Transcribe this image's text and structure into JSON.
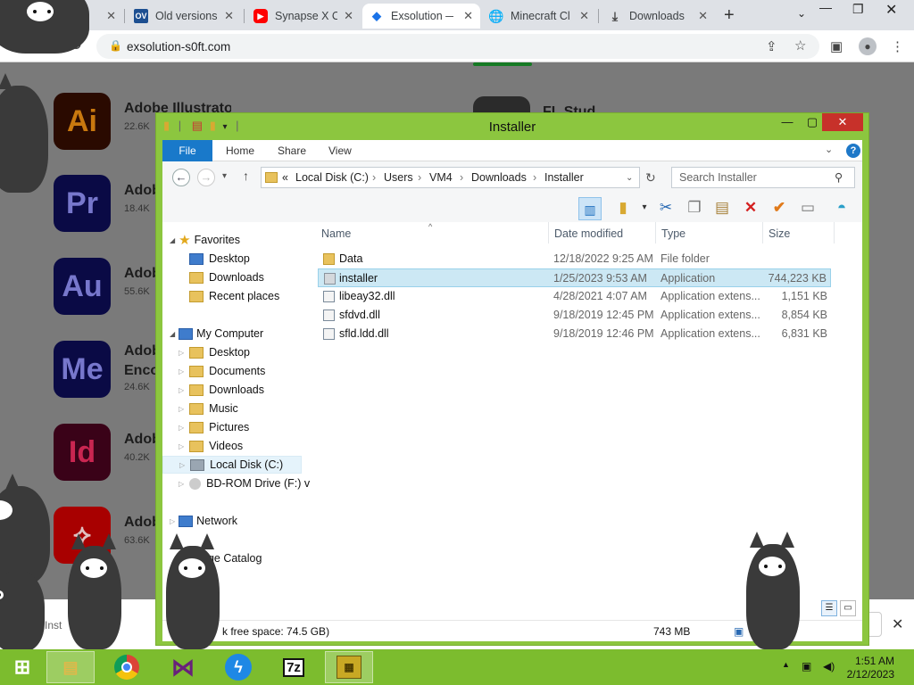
{
  "browser": {
    "tabs": [
      {
        "label": "",
        "icon": "cat-icon"
      },
      {
        "label": "Old versions",
        "icon": "ov-icon",
        "iconText": "OV"
      },
      {
        "label": "Synapse X C",
        "icon": "youtube-icon"
      },
      {
        "label": "Exsolution —",
        "icon": "exsolution-icon"
      },
      {
        "label": "Minecraft Cl",
        "icon": "globe-icon"
      },
      {
        "label": "Downloads",
        "icon": "download-icon"
      }
    ],
    "url": "exsolution-s0ft.com"
  },
  "webpage": {
    "apps": [
      {
        "name": "Adobe Illustrator",
        "downloads": "22.6K",
        "icon": "Ai",
        "bg": "#330000",
        "fg": "#ff9a00"
      },
      {
        "name": "Adobe Premiere Pro",
        "downloads": "18.4K",
        "icon": "Pr",
        "bg": "#00005b",
        "fg": "#9999ff"
      },
      {
        "name": "Adobe Audition",
        "downloads": "55.6K",
        "icon": "Au",
        "bg": "#00005b",
        "fg": "#9999ff"
      },
      {
        "name": "Adobe Media Encoder",
        "name_line2": "Enco",
        "downloads": "24.6K",
        "icon": "Me",
        "bg": "#00005b",
        "fg": "#9999ff"
      },
      {
        "name": "Adobe InDesign",
        "downloads": "40.2K",
        "icon": "Id",
        "bg": "#49021f",
        "fg": "#ff3366"
      },
      {
        "name": "Adobe Acrobat",
        "downloads": "63.6K",
        "icon": "acrobat-icon",
        "bg": "#cf0000",
        "fg": "#ffffff"
      }
    ],
    "right_app": {
      "name": "FL Studio"
    },
    "bottom_text": "Inst"
  },
  "explorer": {
    "title": "Installer",
    "ribbon_tabs": [
      "File",
      "Home",
      "Share",
      "View"
    ],
    "breadcrumb": [
      "«",
      "Local Disk (C:)",
      "Users",
      "VM4",
      "Downloads",
      "Installer"
    ],
    "search_placeholder": "Search Installer",
    "columns": [
      "Name",
      "Date modified",
      "Type",
      "Size"
    ],
    "files": [
      {
        "name": "Data",
        "date": "12/18/2022 9:25 AM",
        "type": "File folder",
        "size": "",
        "icon": "folder-icon"
      },
      {
        "name": "installer",
        "date": "1/25/2023 9:53 AM",
        "type": "Application",
        "size": "744,223 KB",
        "icon": "application-icon",
        "selected": true
      },
      {
        "name": "libeay32.dll",
        "date": "4/28/2021 4:07 AM",
        "type": "Application extens...",
        "size": "1,151 KB",
        "icon": "dll-icon"
      },
      {
        "name": "sfdvd.dll",
        "date": "9/18/2019 12:45 PM",
        "type": "Application extens...",
        "size": "8,854 KB",
        "icon": "dll-icon"
      },
      {
        "name": "sfld.ldd.dll",
        "date": "9/18/2019 12:46 PM",
        "type": "Application extens...",
        "size": "6,831 KB",
        "icon": "dll-icon"
      }
    ],
    "nav": {
      "favorites": "Favorites",
      "fav_items": [
        "Desktop",
        "Downloads",
        "Recent places"
      ],
      "computer": "My Computer",
      "comp_items": [
        "Desktop",
        "Documents",
        "Downloads",
        "Music",
        "Pictures",
        "Videos",
        "Local Disk (C:)",
        "BD-ROM Drive (F:) v"
      ],
      "network": "Network",
      "catalog": "age Catalog"
    },
    "status_left": "k free space: 74.5 GB)",
    "status_right": "743 MB"
  },
  "taskbar": {
    "time": "1:51 AM",
    "date": "2/12/2023",
    "apps": [
      "file-explorer",
      "chrome",
      "visual-studio",
      "lightning-app",
      "7zip",
      "installer-app"
    ],
    "sevenzip_label": "7z"
  },
  "colors": {
    "window_frame": "#8cc63f",
    "taskbar": "#7cbc2e",
    "selection": "#cce8f4",
    "close": "#c7312a"
  }
}
